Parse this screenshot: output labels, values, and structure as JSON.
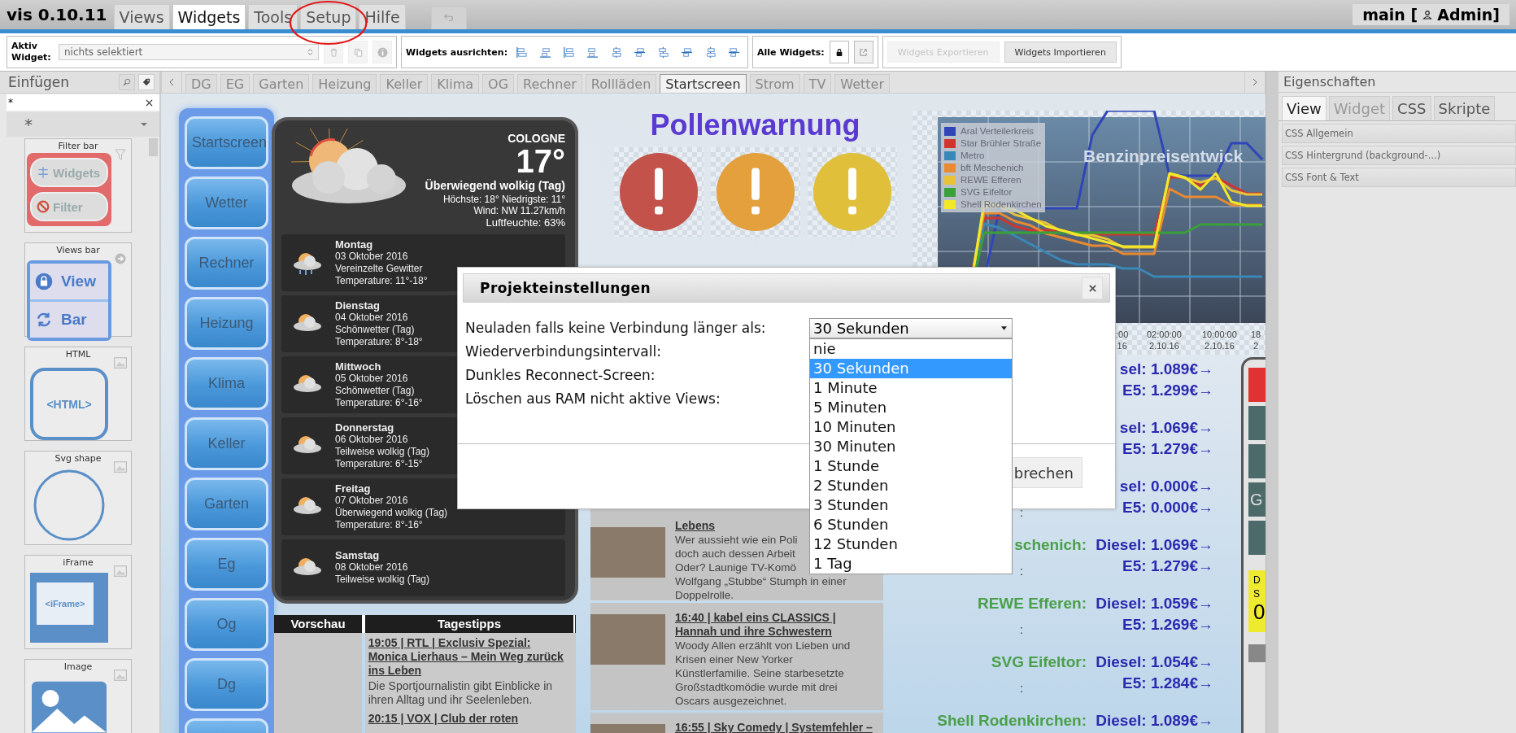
{
  "topbar": {
    "app_title": "vis 0.10.11",
    "menu": [
      {
        "label": "Views",
        "selected": false,
        "circled": false
      },
      {
        "label": "Widgets",
        "selected": true,
        "circled": false
      },
      {
        "label": "Tools",
        "selected": false,
        "circled": false
      },
      {
        "label": "Setup",
        "selected": false,
        "circled": true
      },
      {
        "label": "Hilfe",
        "selected": false,
        "circled": false
      }
    ],
    "project": "main [",
    "user": "Admin]"
  },
  "toolbar": {
    "active_widget_label": "Aktiv Widget:",
    "active_widget_value": "nichts selektiert",
    "align_label": "Widgets ausrichten:",
    "all_widgets_label": "Alle Widgets:",
    "buttons": [
      {
        "label": "Widgets Exportieren",
        "disabled": true
      },
      {
        "label": "Widgets Importieren",
        "disabled": false
      }
    ]
  },
  "insert_panel": {
    "title": "Einfügen",
    "filter_value": "*",
    "category_value": "*",
    "widgets": [
      {
        "kind": "filterbar",
        "name": "Filter bar",
        "texts": [
          "Widgets",
          "Filter"
        ]
      },
      {
        "kind": "viewsbar",
        "name": "Views bar",
        "texts": [
          "View",
          "Bar"
        ]
      },
      {
        "kind": "html",
        "name": "HTML",
        "texts": [
          "<HTML>"
        ]
      },
      {
        "kind": "svg",
        "name": "Svg shape"
      },
      {
        "kind": "iframe",
        "name": "iFrame",
        "texts": [
          "<iFrame>"
        ]
      },
      {
        "kind": "image",
        "name": "Image"
      }
    ]
  },
  "view_tabs": [
    {
      "label": "DG",
      "selected": false
    },
    {
      "label": "EG",
      "selected": false
    },
    {
      "label": "Garten",
      "selected": false
    },
    {
      "label": "Heizung",
      "selected": false
    },
    {
      "label": "Keller",
      "selected": false
    },
    {
      "label": "Klima",
      "selected": false
    },
    {
      "label": "OG",
      "selected": false
    },
    {
      "label": "Rechner",
      "selected": false
    },
    {
      "label": "Rollläden",
      "selected": false
    },
    {
      "label": "Startscreen",
      "selected": true
    },
    {
      "label": "Strom",
      "selected": false
    },
    {
      "label": "TV",
      "selected": false
    },
    {
      "label": "Wetter",
      "selected": false
    }
  ],
  "properties": {
    "title": "Eigenschaften",
    "tabs": [
      {
        "label": "View",
        "selected": true,
        "disabled": false
      },
      {
        "label": "Widget",
        "selected": false,
        "disabled": true
      },
      {
        "label": "CSS",
        "selected": false,
        "disabled": false
      },
      {
        "label": "Skripte",
        "selected": false,
        "disabled": false
      }
    ],
    "sections": [
      "CSS Allgemein",
      "CSS Hintergrund (background-...)",
      "CSS Font & Text"
    ]
  },
  "canvas": {
    "nav_buttons": [
      "Startscreen",
      "Wetter",
      "Rechner",
      "Heizung",
      "Klima",
      "Keller",
      "Garten",
      "Eg",
      "Og",
      "Dg"
    ],
    "weather": {
      "city": "COLOGNE",
      "temperature": "17°",
      "condition": "Überwiegend wolkig (Tag)",
      "minmax": "Höchste: 18° Niedrigste: 11°",
      "wind": "Wind: NW 11.27km/h",
      "humidity": "Luftfeuchte: 63%",
      "days": [
        {
          "day": "Montag",
          "date": "03 Oktober 2016",
          "text": "Vereinzelte Gewitter",
          "temp": "Temperature: 11°-18°",
          "kind": "storm"
        },
        {
          "day": "Dienstag",
          "date": "04 Oktober 2016",
          "text": "Schönwetter (Tag)",
          "temp": "Temperature: 8°-18°",
          "kind": "cloudy"
        },
        {
          "day": "Mittwoch",
          "date": "05 Oktober 2016",
          "text": "Schönwetter (Tag)",
          "temp": "Temperature: 6°-16°",
          "kind": "cloudy"
        },
        {
          "day": "Donnerstag",
          "date": "06 Oktober 2016",
          "text": "Teilweise wolkig (Tag)",
          "temp": "Temperature: 6°-15°",
          "kind": "cloudy"
        },
        {
          "day": "Freitag",
          "date": "07 Oktober 2016",
          "text": "Überwiegend wolkig (Tag)",
          "temp": "Temperature: 8°-16°",
          "kind": "cloudy"
        },
        {
          "day": "Samstag",
          "date": "08 Oktober 2016",
          "text": "Teilweise wolkig (Tag)",
          "kind": "cloudy"
        }
      ]
    },
    "tv_tips": {
      "headers": [
        "Vorschau",
        "Tagestipps"
      ],
      "items": [
        {
          "title": "19:05 | RTL | Exclusiv Spezial: Monica Lierhaus – Mein Weg zurück ins Leben",
          "text": "Die Sportjournalistin gibt Einblicke in ihren Alltag und ihr Seelenleben."
        },
        {
          "title": "20:15 | VOX | Club der roten"
        }
      ]
    },
    "tv_tips_2": {
      "items": [
        {
          "title": "Lebens",
          "lines": [
            "Wer aussieht wie ein Poli",
            "doch auch dessen Arbeit",
            "Oder? Launige TV-Komö",
            "Wolfgang „Stubbe“ Stumph in einer",
            "Doppelrolle."
          ]
        },
        {
          "title": "16:40 | kabel eins CLASSICS | Hannah und ihre Schwestern",
          "lines": [
            "Woody Allen erzählt von Lieben und",
            "Krisen einer New Yorker",
            "Künstlerfamilie. Seine starbesetzte",
            "Großstadtkomödie wurde mit drei",
            "Oscars ausgezeichnet."
          ]
        },
        {
          "title": "16:55 | Sky Comedy | Systemfehler –"
        }
      ]
    },
    "pollen": {
      "title": "Pollenwarnung",
      "warnings": [
        {
          "color": "#c2524a"
        },
        {
          "color": "#e3a03c"
        },
        {
          "color": "#e0bf3a"
        }
      ]
    },
    "fuel_chart": {
      "title": "Benzinpreisentwick",
      "legend": [
        {
          "name": "Aral Verteilerkreis",
          "color": "#2f45b8"
        },
        {
          "name": "Star Brühler Straße",
          "color": "#d03530"
        },
        {
          "name": "Metro",
          "color": "#3a88b8"
        },
        {
          "name": "bft Meschenich",
          "color": "#ea8a30"
        },
        {
          "name": "REWE Efferen",
          "color": "#eac23a"
        },
        {
          "name": "SVG Eifeltor",
          "color": "#3aa03a"
        },
        {
          "name": "Shell Rodenkirchen",
          "color": "#f2e82a"
        }
      ],
      "axis_labels": [
        {
          "time": ":00",
          "date": "16"
        },
        {
          "time": "02:00:00",
          "date": "2.10.16"
        },
        {
          "time": "10:00:00",
          "date": "2.10.16"
        },
        {
          "time": "18",
          "date": "2"
        }
      ]
    },
    "prices": [
      {
        "diesel": "sel: 1.089€→",
        "e5": "E5: 1.299€→"
      },
      {
        "diesel": "sel: 1.069€→",
        "e5": "E5: 1.279€→"
      },
      {
        "diesel": "sel: 0.000€→",
        "e5": "E5: 0.000€→",
        "sep": ":"
      },
      {
        "station": "schenich:",
        "diesel": "Diesel: 1.069€→",
        "e5": "E5: 1.279€→",
        "sep": ":"
      },
      {
        "station": "REWE Efferen:",
        "diesel": "Diesel: 1.059€→",
        "e5": "E5: 1.269€→",
        "sep": ":"
      },
      {
        "station": "SVG Eifeltor:",
        "diesel": "Diesel: 1.054€→",
        "e5": "E5: 1.284€→",
        "sep": ":"
      },
      {
        "station": "Shell Rodenkirchen:",
        "diesel": "Diesel: 1.089€→"
      }
    ],
    "side_widget": {
      "tiles": [
        {
          "color": "#e03232"
        },
        {
          "color": "#4d6a6a"
        },
        {
          "color": "#4d6a6a"
        },
        {
          "color": "#4d6a6a",
          "text": "G"
        },
        {
          "color": "#4d6a6a"
        }
      ],
      "note_lines": [
        "D",
        "S"
      ],
      "note_value": "0"
    }
  },
  "modal": {
    "title": "Projekteinstellungen",
    "fields": [
      {
        "label": "Neuladen falls keine Verbindung länger als:",
        "value": "30 Sekunden",
        "open": true
      },
      {
        "label": "Wiederverbindungsintervall:"
      },
      {
        "label": "Dunkles Reconnect-Screen:"
      },
      {
        "label": "Löschen aus RAM nicht aktive Views:"
      }
    ],
    "options": [
      {
        "label": "nie",
        "selected": false
      },
      {
        "label": "30 Sekunden",
        "selected": true
      },
      {
        "label": "1 Minute",
        "selected": false
      },
      {
        "label": "5 Minuten",
        "selected": false
      },
      {
        "label": "10 Minuten",
        "selected": false
      },
      {
        "label": "30 Minuten",
        "selected": false
      },
      {
        "label": "1 Stunde",
        "selected": false
      },
      {
        "label": "2 Stunden",
        "selected": false
      },
      {
        "label": "3 Stunden",
        "selected": false
      },
      {
        "label": "6 Stunden",
        "selected": false
      },
      {
        "label": "12 Stunden",
        "selected": false
      },
      {
        "label": "1 Tag",
        "selected": false
      }
    ],
    "button": "brechen"
  }
}
